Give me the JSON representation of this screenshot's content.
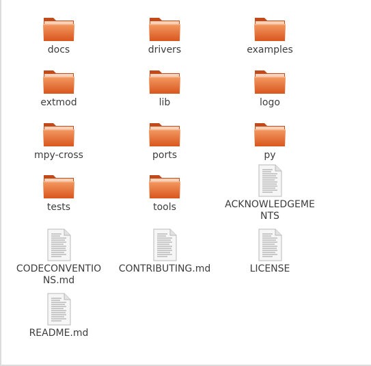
{
  "window": {
    "view_type": "file-manager-icon-view"
  },
  "colors": {
    "folder_dark": "#c24a1a",
    "folder_mid": "#e06a32",
    "folder_light": "#f0945e",
    "text": "#3c3c3c",
    "paper": "#f4f4f4",
    "paper_line": "#9a9a9a"
  },
  "items": [
    {
      "name": "docs",
      "label": "docs",
      "kind": "folder",
      "icon": "folder-icon"
    },
    {
      "name": "drivers",
      "label": "drivers",
      "kind": "folder",
      "icon": "folder-icon"
    },
    {
      "name": "examples",
      "label": "examples",
      "kind": "folder",
      "icon": "folder-icon"
    },
    {
      "name": "extmod",
      "label": "extmod",
      "kind": "folder",
      "icon": "folder-icon"
    },
    {
      "name": "lib",
      "label": "lib",
      "kind": "folder",
      "icon": "folder-icon"
    },
    {
      "name": "logo",
      "label": "logo",
      "kind": "folder",
      "icon": "folder-icon"
    },
    {
      "name": "mpy-cross",
      "label": "mpy-cross",
      "kind": "folder",
      "icon": "folder-icon"
    },
    {
      "name": "ports",
      "label": "ports",
      "kind": "folder",
      "icon": "folder-icon"
    },
    {
      "name": "py",
      "label": "py",
      "kind": "folder",
      "icon": "folder-icon"
    },
    {
      "name": "tests",
      "label": "tests",
      "kind": "folder",
      "icon": "folder-icon"
    },
    {
      "name": "tools",
      "label": "tools",
      "kind": "folder",
      "icon": "folder-icon"
    },
    {
      "name": "acknowledgements",
      "label": "ACKNOWLEDGEME\nNTS",
      "kind": "file",
      "icon": "text-file-icon"
    },
    {
      "name": "codeconventions",
      "label": "CODECONVENTIO\nNS.md",
      "kind": "file",
      "icon": "text-file-icon"
    },
    {
      "name": "contributing",
      "label": "CONTRIBUTING.md",
      "kind": "file",
      "icon": "text-file-icon"
    },
    {
      "name": "license",
      "label": "LICENSE",
      "kind": "file",
      "icon": "text-file-icon"
    },
    {
      "name": "readme",
      "label": "README.md",
      "kind": "file",
      "icon": "text-file-icon"
    }
  ]
}
